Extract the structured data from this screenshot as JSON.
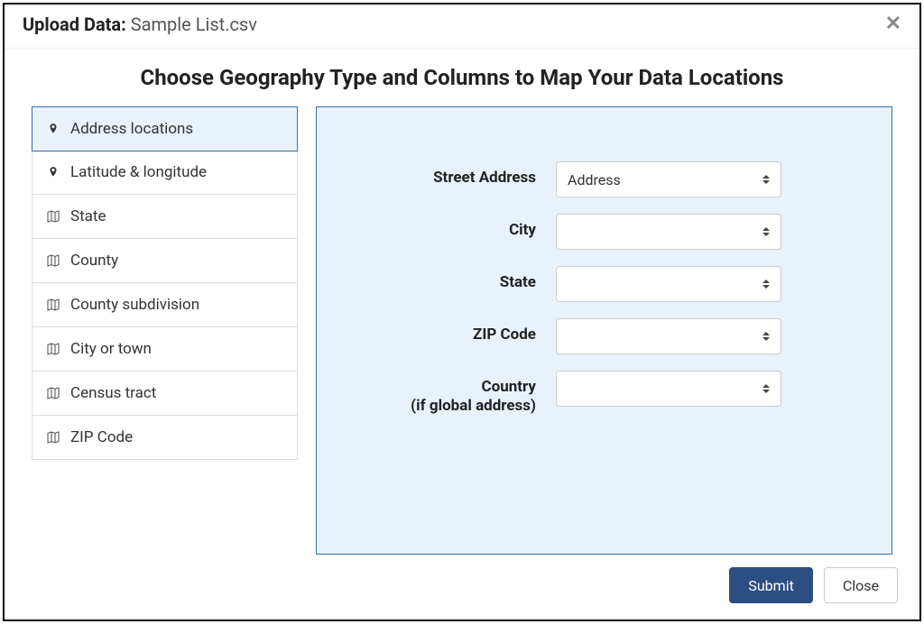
{
  "header": {
    "title_prefix": "Upload Data:",
    "filename": "Sample List.csv"
  },
  "heading": "Choose Geography Type and Columns to Map Your Data Locations",
  "sidebar": {
    "items": [
      {
        "label": "Address locations",
        "icon": "pin",
        "selected": true
      },
      {
        "label": "Latitude & longitude",
        "icon": "pin",
        "selected": false
      },
      {
        "label": "State",
        "icon": "map",
        "selected": false
      },
      {
        "label": "County",
        "icon": "map",
        "selected": false
      },
      {
        "label": "County subdivision",
        "icon": "map",
        "selected": false
      },
      {
        "label": "City or town",
        "icon": "map",
        "selected": false
      },
      {
        "label": "Census tract",
        "icon": "map",
        "selected": false
      },
      {
        "label": "ZIP Code",
        "icon": "map",
        "selected": false
      }
    ]
  },
  "form": {
    "fields": [
      {
        "label": "Street Address",
        "sublabel": "",
        "value": "Address"
      },
      {
        "label": "City",
        "sublabel": "",
        "value": ""
      },
      {
        "label": "State",
        "sublabel": "",
        "value": ""
      },
      {
        "label": "ZIP Code",
        "sublabel": "",
        "value": ""
      },
      {
        "label": "Country",
        "sublabel": "(if global address)",
        "value": ""
      }
    ]
  },
  "footer": {
    "submit": "Submit",
    "close": "Close"
  }
}
